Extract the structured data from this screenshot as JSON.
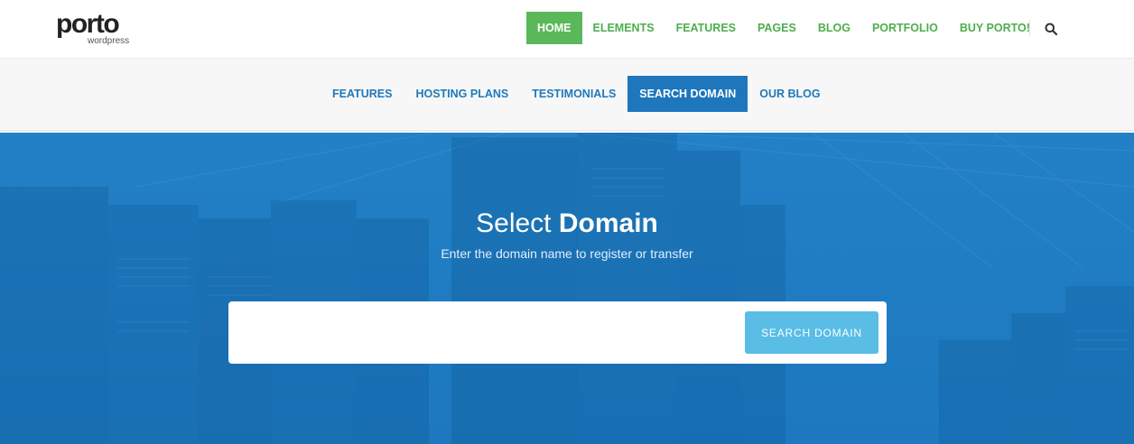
{
  "header": {
    "logo_text": "porto",
    "logo_subtext": "wordpress",
    "nav": [
      {
        "label": "HOME",
        "active": true
      },
      {
        "label": "ELEMENTS"
      },
      {
        "label": "FEATURES"
      },
      {
        "label": "PAGES"
      },
      {
        "label": "BLOG"
      },
      {
        "label": "PORTFOLIO"
      },
      {
        "label": "BUY PORTO!"
      }
    ],
    "search_icon": "search-icon"
  },
  "subnav": {
    "items": [
      {
        "label": "FEATURES"
      },
      {
        "label": "HOSTING PLANS"
      },
      {
        "label": "TESTIMONIALS"
      },
      {
        "label": "SEARCH DOMAIN",
        "active": true
      },
      {
        "label": "OUR BLOG"
      }
    ]
  },
  "hero": {
    "title_light": "Select",
    "title_bold": "Domain",
    "subtitle": "Enter the domain name to register or transfer",
    "input_value": "",
    "button_label": "SEARCH DOMAIN"
  },
  "colors": {
    "nav_green": "#4eae4e",
    "nav_active_bg": "#5bb85a",
    "subnav_blue": "#1f79b9",
    "subnav_active_bg": "#1e76bd",
    "hero_blue": "#2380c6",
    "button_light_blue": "#59bde6"
  }
}
